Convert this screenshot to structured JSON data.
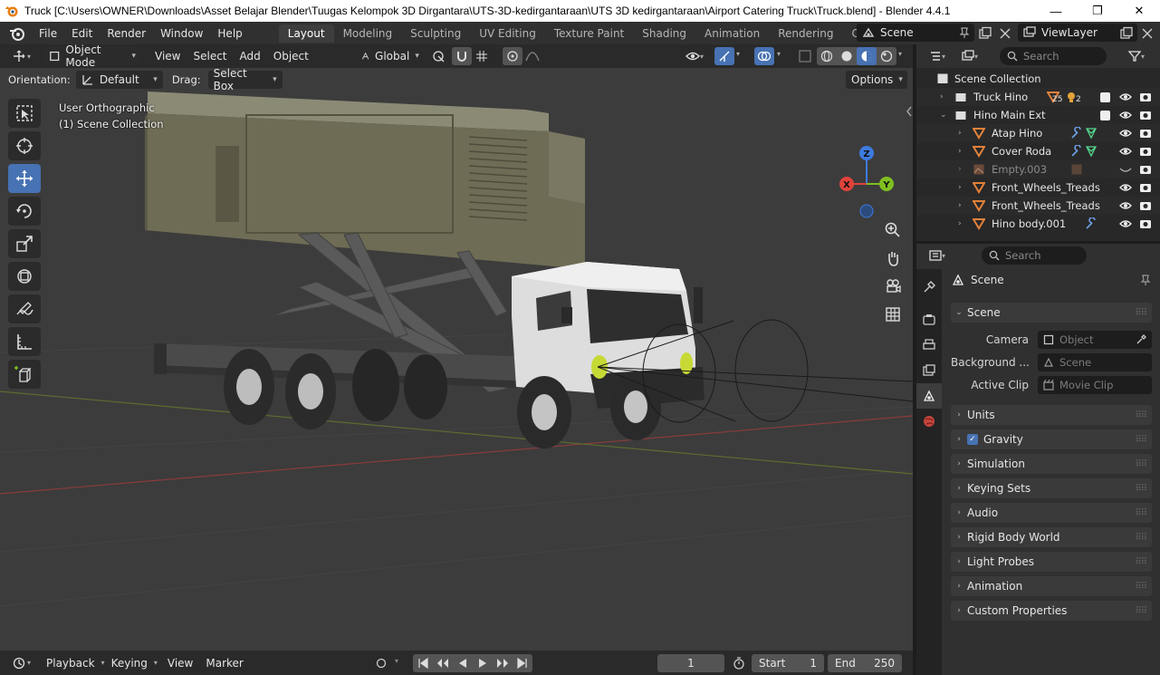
{
  "window": {
    "title": "Truck [C:\\Users\\OWNER\\Downloads\\Asset Belajar Blender\\Tuugas Kelompok 3D Dirgantara\\UTS-3D-kedirgantaraan\\UTS 3D kedirgantaraan\\Airport Catering Truck\\Truck.blend] - Blender 4.4.1",
    "minimize": "—",
    "maximize": "❐",
    "close": "✕"
  },
  "menubar": {
    "menus": [
      "File",
      "Edit",
      "Render",
      "Window",
      "Help"
    ],
    "tabs": [
      "Layout",
      "Modeling",
      "Sculpting",
      "UV Editing",
      "Texture Paint",
      "Shading",
      "Animation",
      "Rendering",
      "Compositing"
    ],
    "active_tab": "Layout",
    "scene": "Scene",
    "view_layer": "ViewLayer"
  },
  "viewport": {
    "mode": "Object Mode",
    "menus": [
      "View",
      "Select",
      "Add",
      "Object"
    ],
    "transform_orientation": "Global",
    "orientation_label": "Orientation:",
    "orientation_value": "Default",
    "drag_label": "Drag:",
    "drag_value": "Select Box",
    "options": "Options",
    "view_name": "User Orthographic",
    "collection_info": "(1) Scene Collection",
    "gizmo_axes": {
      "x": "X",
      "y": "Y",
      "z": "Z"
    }
  },
  "timeline": {
    "menus": [
      "Playback",
      "Keying",
      "View",
      "Marker"
    ],
    "current_frame": "1",
    "start_label": "Start",
    "start_value": "1",
    "end_label": "End",
    "end_value": "250"
  },
  "outliner": {
    "search_placeholder": "Search",
    "root": "Scene Collection",
    "rows": [
      {
        "name": "Truck Hino",
        "count_a": "25",
        "count_b": "2"
      },
      {
        "name": "Hino Main Ext"
      },
      {
        "name": "Atap Hino"
      },
      {
        "name": "Cover Roda"
      },
      {
        "name": "Empty.003"
      },
      {
        "name": "Front_Wheels_Treads"
      },
      {
        "name": "Front_Wheels_Treads"
      },
      {
        "name": "Hino body.001"
      }
    ]
  },
  "properties": {
    "search_placeholder": "Search",
    "context": "Scene",
    "panel_scene": "Scene",
    "camera_label": "Camera",
    "camera_placeholder": "Object",
    "background_label": "Background ...",
    "background_placeholder": "Scene",
    "active_clip_label": "Active Clip",
    "active_clip_placeholder": "Movie Clip",
    "panels": [
      "Units",
      "Gravity",
      "Simulation",
      "Keying Sets",
      "Audio",
      "Rigid Body World",
      "Light Probes",
      "Animation",
      "Custom Properties"
    ]
  },
  "colors": {
    "accent": "#4772b3",
    "axis_x": "#e0433b",
    "axis_y": "#7fbf1f",
    "axis_z": "#3d7be0",
    "mesh_orange": "#e3823a"
  }
}
